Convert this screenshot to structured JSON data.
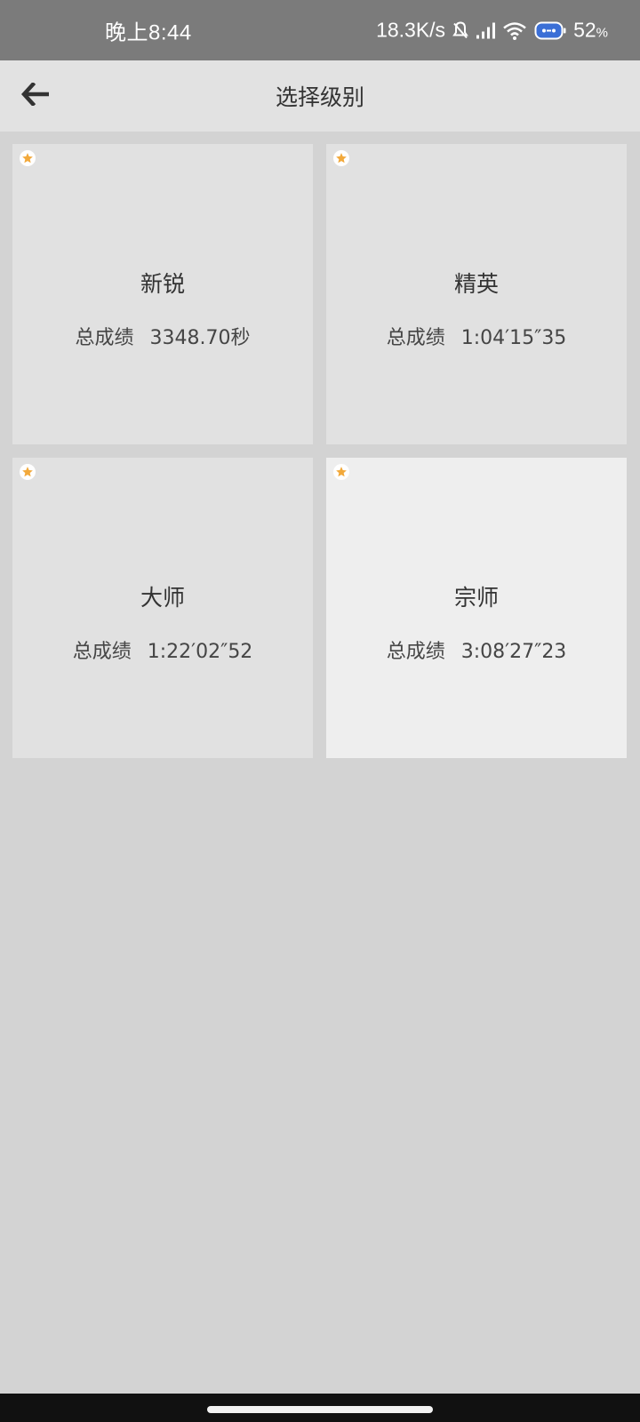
{
  "status_bar": {
    "time": "晚上8:44",
    "network_speed": "18.3K/s",
    "battery_percent": "52",
    "battery_unit": "%",
    "icons": [
      "bell-off-icon",
      "signal-icon",
      "wifi-icon",
      "battery-saver-icon"
    ]
  },
  "app_bar": {
    "title": "选择级别",
    "back_icon": "arrow-left-icon"
  },
  "levels": [
    {
      "name": "新锐",
      "score_label": "总成绩",
      "score": "3348.70秒",
      "starred": true
    },
    {
      "name": "精英",
      "score_label": "总成绩",
      "score": "1:04′15″35",
      "starred": true
    },
    {
      "name": "大师",
      "score_label": "总成绩",
      "score": "1:22′02″52",
      "starred": true
    },
    {
      "name": "宗师",
      "score_label": "总成绩",
      "score": "3:08′27″23",
      "starred": true
    }
  ],
  "colors": {
    "star": "#f2a93b",
    "card_bg": "#e1e1e1",
    "card_bg_selected": "#eeeeee",
    "page_bg": "#d3d3d3"
  }
}
